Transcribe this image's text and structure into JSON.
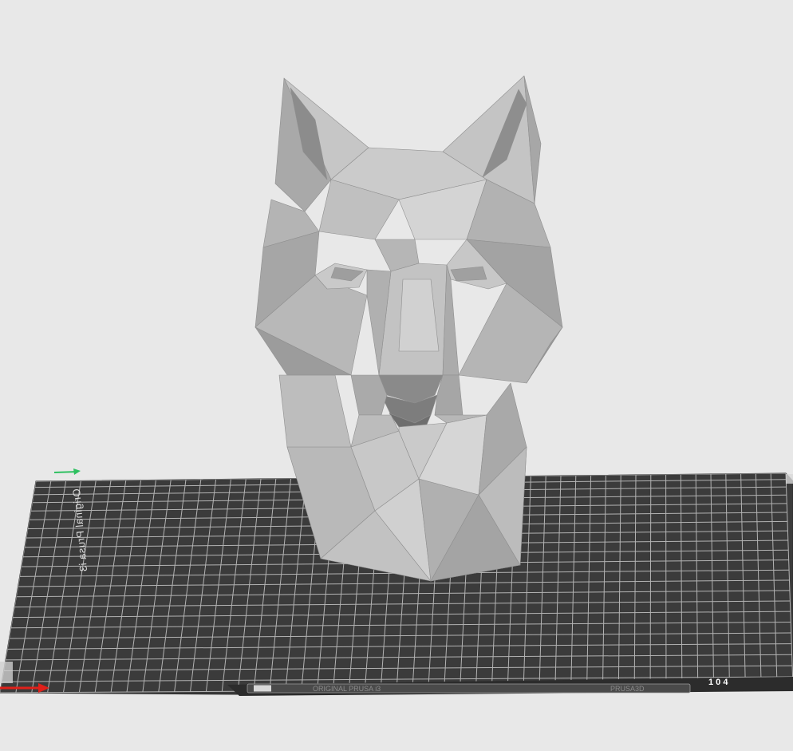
{
  "viewport": {
    "background_color": "#e8e8e8",
    "bed_color": "#3a3a3a",
    "grid_color": "#cfcfcf",
    "model_color": "#b4b4b4",
    "axis_x_color": "#e0201a",
    "axis_y_color": "#2ec060"
  },
  "bed": {
    "brand_label": "Original Prusa i3",
    "strip_text_left": "ORIGINAL PRUSA i3",
    "strip_text_right": "PRUSA3D",
    "strip_id": "1 0 4"
  },
  "model": {
    "name": "wolf-head-lowpoly"
  }
}
